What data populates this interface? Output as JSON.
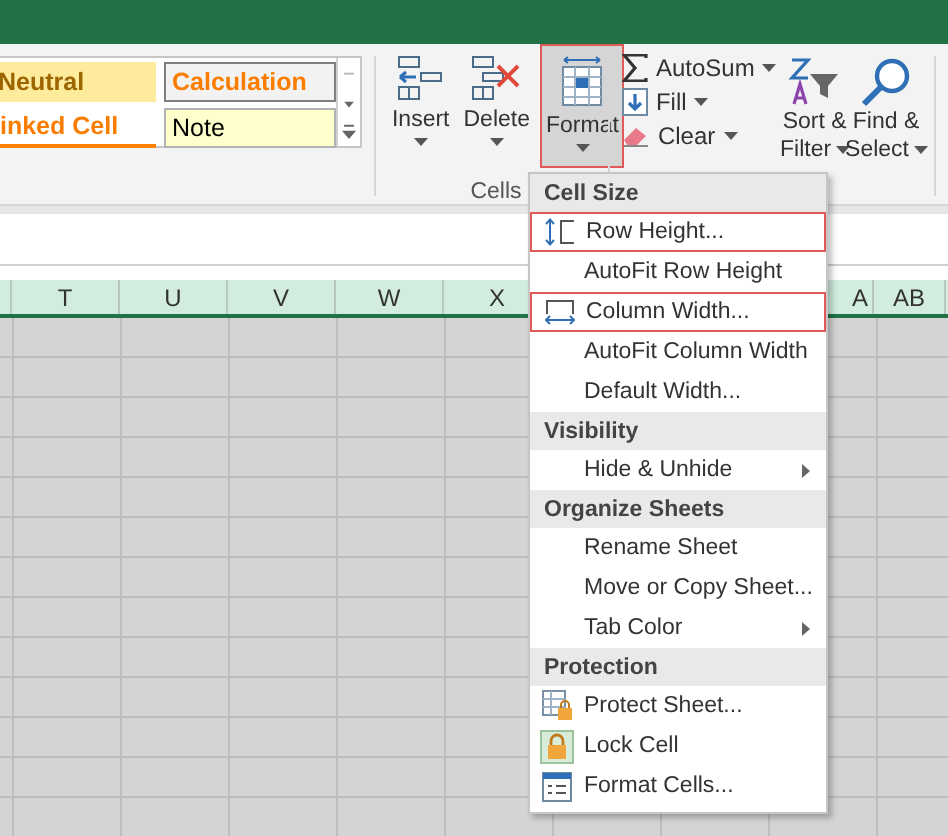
{
  "cell_styles": [
    {
      "label": "Neutral",
      "kind": "neutral"
    },
    {
      "label": "Calculation",
      "kind": "calculation"
    },
    {
      "label": "inked Cell",
      "kind": "linked"
    },
    {
      "label": "Note",
      "kind": "note"
    }
  ],
  "cells_group": {
    "label": "Cells",
    "buttons": [
      {
        "label": "Insert",
        "kind": "insert",
        "selected": false
      },
      {
        "label": "Delete",
        "kind": "delete",
        "selected": false
      },
      {
        "label": "Format",
        "kind": "format",
        "selected": true
      }
    ]
  },
  "editing_group": {
    "commands": [
      {
        "label": "AutoSum",
        "kind": "autosum"
      },
      {
        "label": "Fill",
        "kind": "fill"
      },
      {
        "label": "Clear",
        "kind": "clear"
      }
    ],
    "large_buttons": [
      {
        "lines": [
          "Sort &",
          "Filter"
        ],
        "kind": "sort"
      },
      {
        "lines": [
          "Find &",
          "Select"
        ],
        "kind": "find"
      }
    ]
  },
  "columns": [
    "T",
    "U",
    "V",
    "W",
    "X",
    "A",
    "AB"
  ],
  "format_menu": {
    "sections": [
      {
        "title": "Cell Size",
        "items": [
          {
            "label": "Row Height...",
            "kind": "row-height",
            "highlighted": true,
            "submenu": false
          },
          {
            "label": "AutoFit Row Height",
            "kind": "plain",
            "highlighted": false,
            "submenu": false
          },
          {
            "label": "Column Width...",
            "kind": "column-width",
            "highlighted": true,
            "submenu": false
          },
          {
            "label": "AutoFit Column Width",
            "kind": "plain",
            "highlighted": false,
            "submenu": false
          },
          {
            "label": "Default Width...",
            "kind": "plain",
            "highlighted": false,
            "submenu": false
          }
        ]
      },
      {
        "title": "Visibility",
        "items": [
          {
            "label": "Hide & Unhide",
            "kind": "plain",
            "highlighted": false,
            "submenu": true
          }
        ]
      },
      {
        "title": "Organize Sheets",
        "items": [
          {
            "label": "Rename Sheet",
            "kind": "plain",
            "highlighted": false,
            "submenu": false
          },
          {
            "label": "Move or Copy Sheet...",
            "kind": "plain",
            "highlighted": false,
            "submenu": false
          },
          {
            "label": "Tab Color",
            "kind": "plain",
            "highlighted": false,
            "submenu": true
          }
        ]
      },
      {
        "title": "Protection",
        "items": [
          {
            "label": "Protect Sheet...",
            "kind": "protect-sheet",
            "highlighted": false,
            "submenu": false
          },
          {
            "label": "Lock Cell",
            "kind": "lock-cell",
            "highlighted": false,
            "submenu": false
          },
          {
            "label": "Format Cells...",
            "kind": "format-cells",
            "highlighted": false,
            "submenu": false
          }
        ]
      }
    ]
  }
}
